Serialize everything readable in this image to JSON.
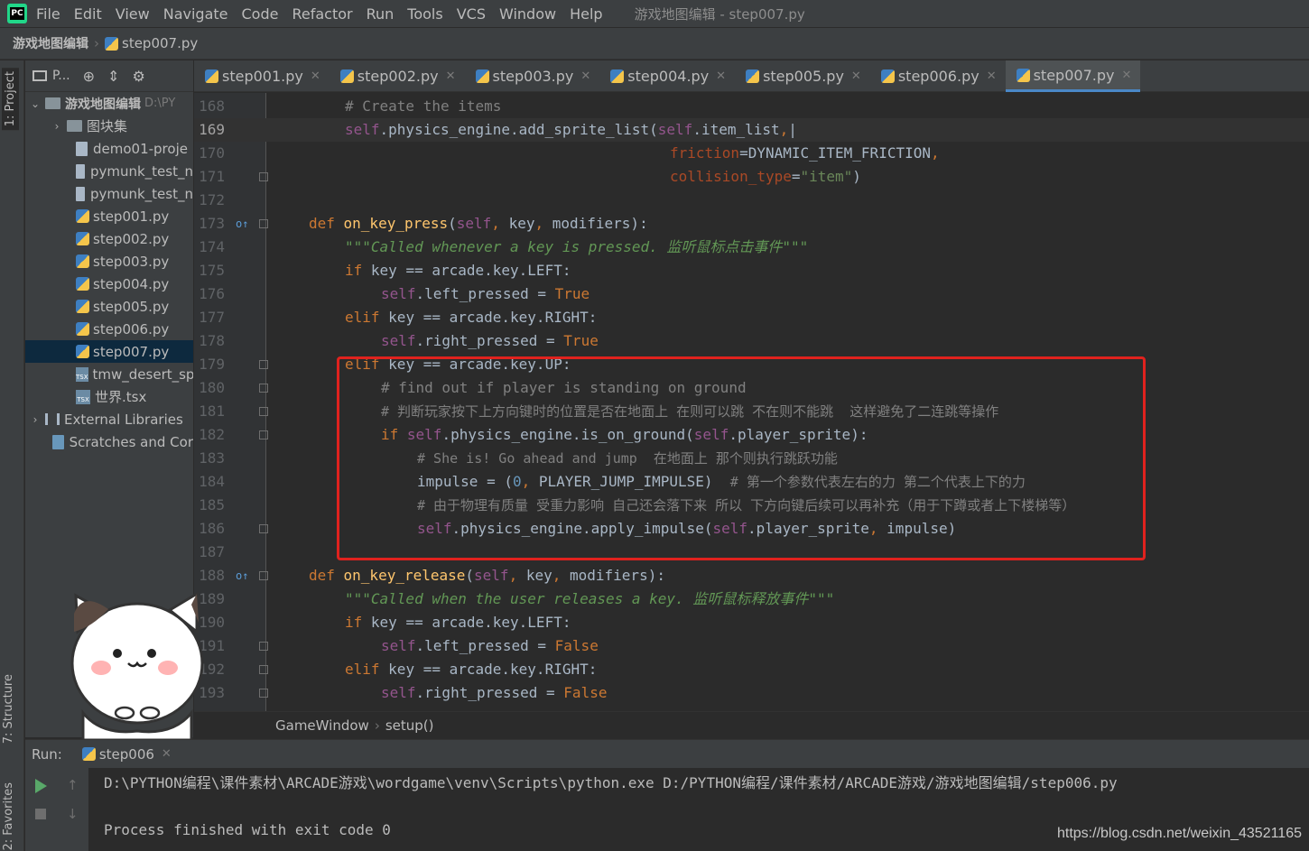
{
  "menubar": {
    "items": [
      "File",
      "Edit",
      "View",
      "Navigate",
      "Code",
      "Refactor",
      "Run",
      "Tools",
      "VCS",
      "Window",
      "Help"
    ],
    "title": "游戏地图编辑 - step007.py"
  },
  "breadcrumb": {
    "project": "游戏地图编辑",
    "file": "step007.py"
  },
  "left_stripe": {
    "project_tab": "1: Project",
    "structure_tab": "7: Structure",
    "favorites_tab": "2: Favorites"
  },
  "project_panel": {
    "view_label": "P...",
    "tree": [
      {
        "label": "游戏地图编辑",
        "suffix": "D:\\PY"
      },
      {
        "label": "图块集"
      },
      {
        "label": "demo01-proje"
      },
      {
        "label": "pymunk_test_n"
      },
      {
        "label": "pymunk_test_n"
      },
      {
        "label": "step001.py"
      },
      {
        "label": "step002.py"
      },
      {
        "label": "step003.py"
      },
      {
        "label": "step004.py"
      },
      {
        "label": "step005.py"
      },
      {
        "label": "step006.py"
      },
      {
        "label": "step007.py"
      },
      {
        "label": "tmw_desert_sp"
      },
      {
        "label": "世界.tsx"
      },
      {
        "label": "External Libraries"
      },
      {
        "label": "Scratches and Cor"
      }
    ]
  },
  "tabs": [
    "step001.py",
    "step002.py",
    "step003.py",
    "step004.py",
    "step005.py",
    "step006.py",
    "step007.py"
  ],
  "editor": {
    "line_numbers": [
      "168",
      "169",
      "170",
      "171",
      "172",
      "173",
      "174",
      "175",
      "176",
      "177",
      "178",
      "179",
      "180",
      "181",
      "182",
      "183",
      "184",
      "185",
      "186",
      "187",
      "188",
      "189",
      "190",
      "191",
      "192",
      "193"
    ],
    "comment_168": "# Create the items",
    "comment_180": "# find out if player is standing on ground",
    "comment_181": "# 判断玩家按下上方向键时的位置是否在地面上 在则可以跳 不在则不能跳  这样避免了二连跳等操作",
    "comment_183": "# She is! Go ahead and jump  在地面上 那个则执行跳跃功能",
    "comment_184": "# 第一个参数代表左右的力 第二个代表上下的力",
    "comment_185": "# 由于物理有质量 受重力影响 自己还会落下来 所以 下方向键后续可以再补充（用于下蹲或者上下楼梯等）",
    "doc_174": "\"\"\"Called whenever a key is pressed. 监听鼠标点击事件\"\"\"",
    "doc_189": "\"\"\"Called when the user releases a key. 监听鼠标释放事件\"\"\""
  },
  "editor_crumb": {
    "class": "GameWindow",
    "method": "setup()"
  },
  "run": {
    "label": "Run:",
    "tab": "step006",
    "line1": "D:\\PYTHON编程\\课件素材\\ARCADE游戏\\wordgame\\venv\\Scripts\\python.exe D:/PYTHON编程/课件素材/ARCADE游戏/游戏地图编辑/step006.py",
    "line2": "Process finished with exit code 0"
  },
  "watermark": "https://blog.csdn.net/weixin_43521165"
}
